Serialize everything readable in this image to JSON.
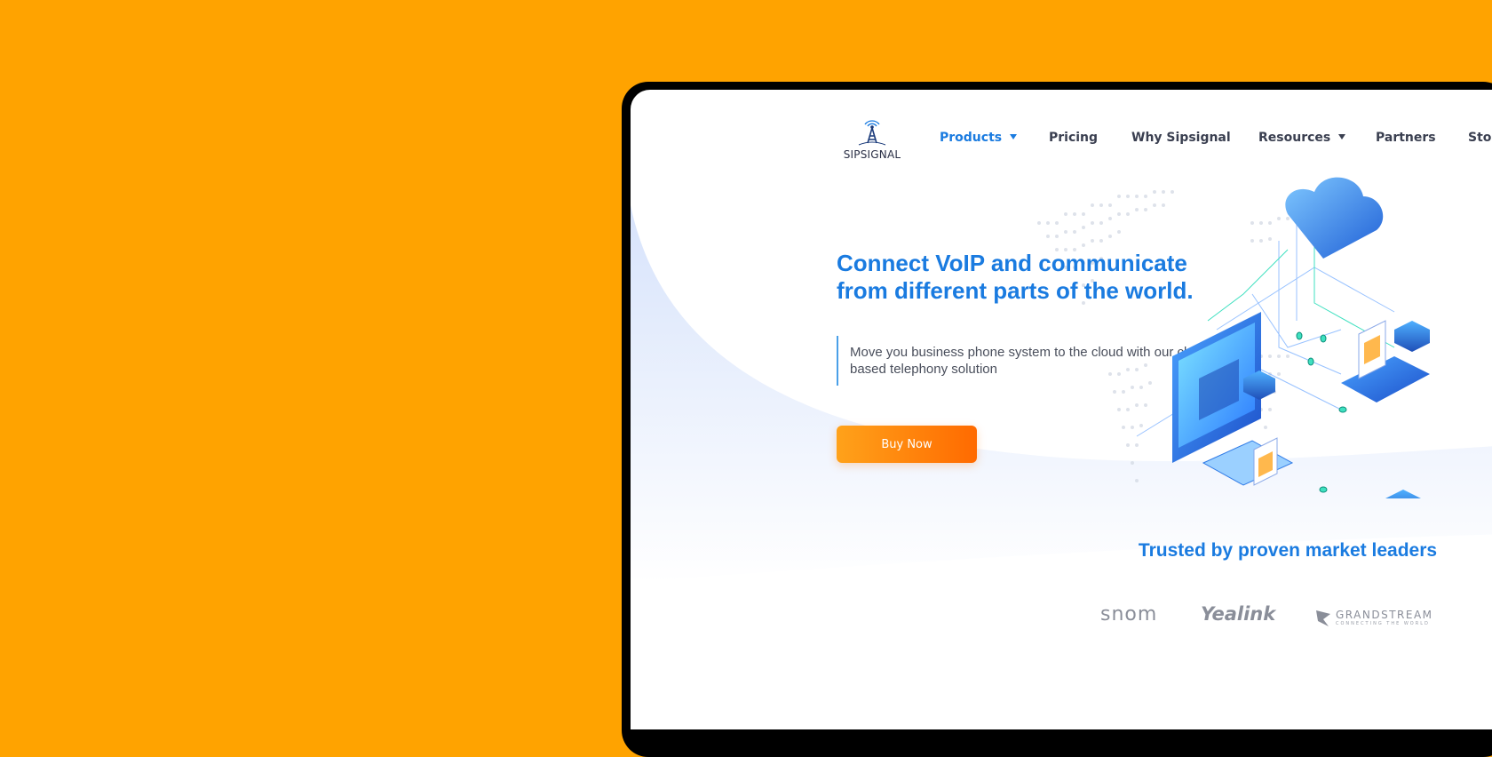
{
  "brand": {
    "name": "SIPSIGNAL"
  },
  "nav": {
    "items": [
      {
        "label": "Products",
        "has_dropdown": true,
        "active": true
      },
      {
        "label": "Pricing",
        "has_dropdown": false
      },
      {
        "label": "Why Sipsignal",
        "has_dropdown": false
      },
      {
        "label": "Resources",
        "has_dropdown": true
      },
      {
        "label": "Partners",
        "has_dropdown": false
      },
      {
        "label": "Stor",
        "has_dropdown": false
      }
    ]
  },
  "hero": {
    "title_line1": "Connect VoIP and communicate",
    "title_line2": "from different parts of the world.",
    "subtitle": "Move you business phone system to the cloud with our cloud based telephony solution",
    "cta_label": "Buy Now"
  },
  "trusted": {
    "heading": "Trusted by proven market leaders",
    "partners": [
      "snom",
      "Yealink",
      "GRANDSTREAM"
    ],
    "grandstream_tagline": "CONNECTING THE WORLD"
  },
  "colors": {
    "page_bg": "#FFA300",
    "accent_blue": "#1a7be0",
    "cta_start": "#FFA21A",
    "cta_end": "#FF6A00",
    "device_frame": "#000000"
  },
  "icons": [
    "tower-icon",
    "caret-down-icon",
    "grandstream-logo-icon"
  ]
}
